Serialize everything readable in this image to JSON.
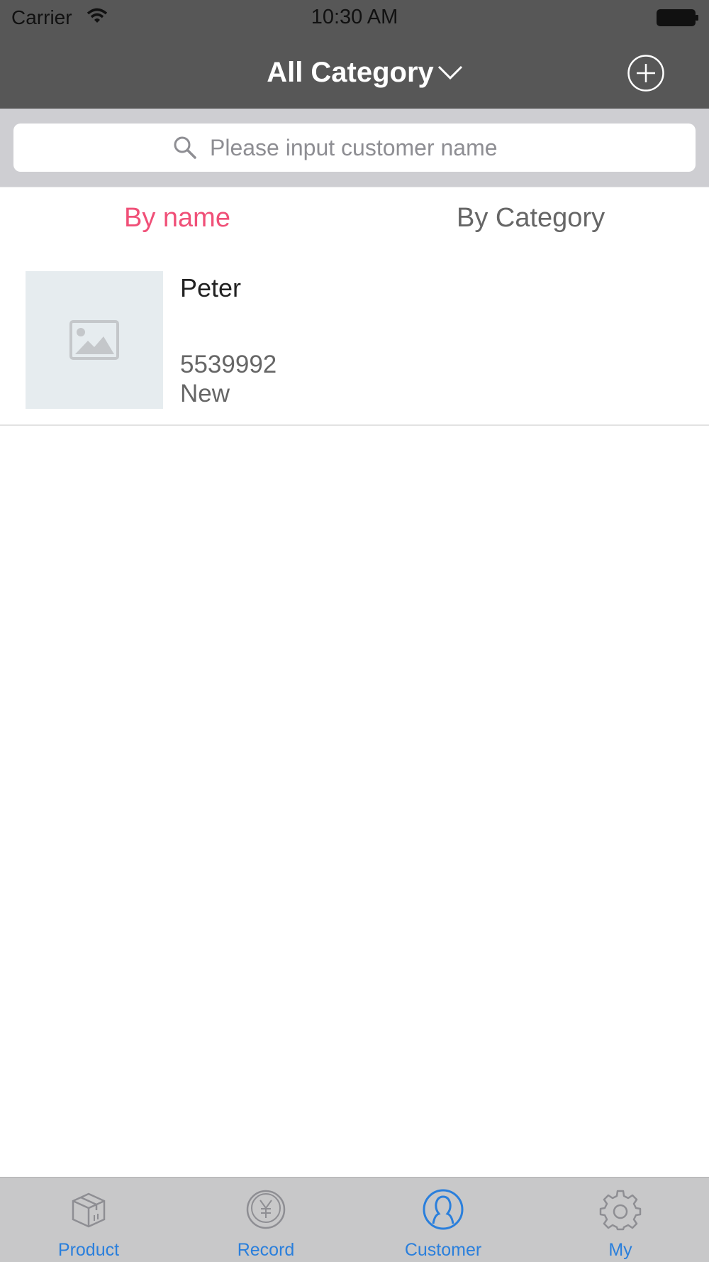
{
  "status_bar": {
    "carrier": "Carrier",
    "time": "10:30 AM"
  },
  "header": {
    "title": "All Category"
  },
  "search": {
    "placeholder": "Please input customer name"
  },
  "tabs": [
    {
      "label": "By name",
      "active": true
    },
    {
      "label": "By Category",
      "active": false
    }
  ],
  "customers": [
    {
      "name": "Peter",
      "phone": "5539992",
      "status": "New"
    }
  ],
  "tab_bar": {
    "items": [
      {
        "label": "Product",
        "icon": "box-icon"
      },
      {
        "label": "Record",
        "icon": "yen-coin-icon"
      },
      {
        "label": "Customer",
        "icon": "person-icon",
        "active": true
      },
      {
        "label": "My",
        "icon": "gear-icon"
      }
    ]
  },
  "colors": {
    "header_bg": "#575757",
    "accent_pink": "#f05078",
    "tab_blue": "#2a7fdc"
  }
}
